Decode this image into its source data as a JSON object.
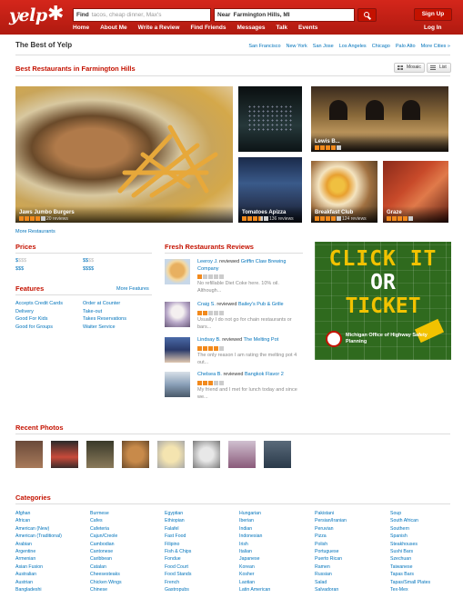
{
  "header": {
    "logo": "yelp",
    "find_label": "Find",
    "find_placeholder": "tacos, cheap dinner, Max's",
    "near_label": "Near",
    "near_value": "Farmington Hills, MI",
    "signup": "Sign Up",
    "login": "Log In",
    "nav": [
      "Home",
      "About Me",
      "Write a Review",
      "Find Friends",
      "Messages",
      "Talk",
      "Events"
    ],
    "brand_color": "#c41200"
  },
  "bestof": {
    "title": "The Best of Yelp",
    "cities": [
      "San Francisco",
      "New York",
      "San Jose",
      "Los Angeles",
      "Chicago",
      "Palo Alto",
      "More Cities »"
    ]
  },
  "best_restaurants": {
    "title": "Best Restaurants in Farmington Hills",
    "view_mosaic": "Mosaic",
    "view_list": "List",
    "tiles": [
      {
        "name": "Jaws Jumbo Burgers",
        "reviews": "20 reviews",
        "rating": 4
      },
      {
        "name": "",
        "reviews": "",
        "rating": 0
      },
      {
        "name": "Lewis B...",
        "reviews": "",
        "rating": 4
      },
      {
        "name": "Tomatoes Apizza",
        "reviews": "136 reviews",
        "rating": 4
      },
      {
        "name": "Breakfast Club",
        "reviews": "124 reviews",
        "rating": 4
      },
      {
        "name": "Graze",
        "reviews": "",
        "rating": 4
      }
    ],
    "more": "More Restaurants"
  },
  "prices": {
    "title": "Prices",
    "items": [
      [
        "$",
        "$$$"
      ],
      [
        "$$",
        "$$"
      ],
      [
        "$$$",
        "$$$"
      ],
      [
        "$$$$",
        "$$$$"
      ]
    ]
  },
  "features": {
    "title": "Features",
    "more": "More Features",
    "col1": [
      "Accepts Credit Cards",
      "Delivery",
      "Good For Kids",
      "Good for Groups"
    ],
    "col2": [
      "Order at Counter",
      "Take-out",
      "Takes Reservations",
      "Waiter Service"
    ]
  },
  "fresh_reviews": {
    "title": "Fresh Restaurants Reviews",
    "items": [
      {
        "user": "Leeroy J.",
        "action": "reviewed",
        "biz": "Griffin Claw Brewing Company",
        "rating": 1,
        "text": "No refillable Diet Coke here. 10% oil. Although..."
      },
      {
        "user": "Craig S.",
        "action": "reviewed",
        "biz": "Bailey's Pub & Grille",
        "rating": 2,
        "text": "Usually I do not go for chain restaurants or bars..."
      },
      {
        "user": "Lindsay B.",
        "action": "reviewed",
        "biz": "The Melting Pot",
        "rating": 4,
        "text": "The only reason I am rating the melting pot 4 out..."
      },
      {
        "user": "Chelsea B.",
        "action": "reviewed",
        "biz": "Bangkok Flavor 2",
        "rating": 3,
        "text": "My friend and I met for lunch today and since we..."
      }
    ]
  },
  "ad": {
    "line1": "CLICK IT",
    "line2": "OR",
    "line3": "TICKET",
    "small": "Michigan Office of Highway Safety Planning"
  },
  "recent_photos": {
    "title": "Recent Photos"
  },
  "categories": {
    "title": "Categories",
    "cols": [
      [
        "Afghan",
        "African",
        "American (New)",
        "American (Traditional)",
        "Arabian",
        "Argentine",
        "Armenian",
        "Asian Fusion",
        "Australian",
        "Austrian",
        "Bangladeshi"
      ],
      [
        "Burmese",
        "Cafes",
        "Cafeteria",
        "Cajun/Creole",
        "Cambodian",
        "Cantonese",
        "Caribbean",
        "Catalan",
        "Cheesesteaks",
        "Chicken Wings",
        "Chinese"
      ],
      [
        "Egyptian",
        "Ethiopian",
        "Falafel",
        "Fast Food",
        "Filipino",
        "Fish & Chips",
        "Fondue",
        "Food Court",
        "Food Stands",
        "French",
        "Gastropubs"
      ],
      [
        "Hungarian",
        "Iberian",
        "Indian",
        "Indonesian",
        "Irish",
        "Italian",
        "Japanese",
        "Korean",
        "Kosher",
        "Laotian",
        "Latin American"
      ],
      [
        "Pakistani",
        "Persian/Iranian",
        "Peruvian",
        "Pizza",
        "Polish",
        "Portuguese",
        "Puerto Rican",
        "Ramen",
        "Russian",
        "Salad",
        "Salvadoran"
      ],
      [
        "Soup",
        "South African",
        "Southern",
        "Spanish",
        "Steakhouses",
        "Sushi Bars",
        "Szechuan",
        "Taiwanese",
        "Tapas Bars",
        "Tapas/Small Plates",
        "Tex-Mex"
      ]
    ]
  }
}
